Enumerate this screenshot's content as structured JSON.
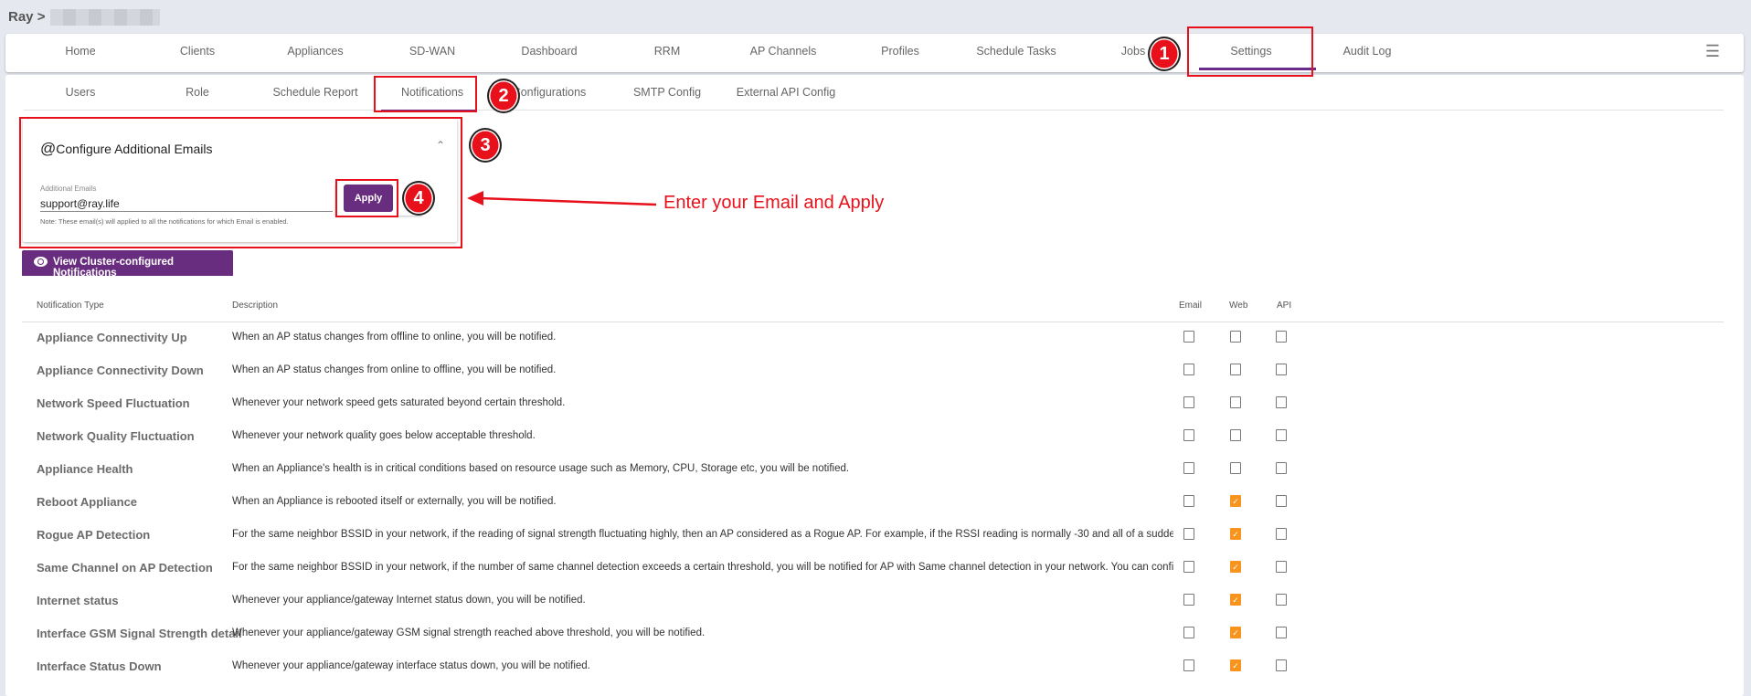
{
  "breadcrumb": {
    "root": "Ray",
    "separator": ">"
  },
  "topnav": {
    "items": [
      "Home",
      "Clients",
      "Appliances",
      "SD-WAN",
      "Dashboard",
      "RRM",
      "AP Channels",
      "Profiles",
      "Schedule Tasks",
      "Jobs",
      "Settings",
      "Audit Log"
    ],
    "active": "Settings"
  },
  "subtabs": {
    "items": [
      "Users",
      "Role",
      "Schedule Report",
      "Notifications",
      "Configurations",
      "SMTP Config",
      "External API Config"
    ],
    "active": "Notifications"
  },
  "email_card": {
    "title": "Configure Additional Emails",
    "field_label": "Additional Emails",
    "field_value": "support@ray.life",
    "note": "Note: These email(s) will applied to all the notifications for which Email is enabled.",
    "apply_label": "Apply"
  },
  "view_button": "View Cluster-configured Notifications",
  "table": {
    "headers": [
      "Notification Type",
      "Description",
      "Email",
      "Web",
      "API"
    ],
    "rows": [
      {
        "type": "Appliance Connectivity Up",
        "desc": "When an AP status changes from offline to online, you will be notified.",
        "email": false,
        "web": false,
        "api": false
      },
      {
        "type": "Appliance Connectivity Down",
        "desc": "When an AP status changes from online to offline, you will be notified.",
        "email": false,
        "web": false,
        "api": false
      },
      {
        "type": "Network Speed Fluctuation",
        "desc": "Whenever your network speed gets saturated beyond certain threshold.",
        "email": false,
        "web": false,
        "api": false
      },
      {
        "type": "Network Quality Fluctuation",
        "desc": "Whenever your network quality goes below acceptable threshold.",
        "email": false,
        "web": false,
        "api": false
      },
      {
        "type": "Appliance Health",
        "desc": "When an Appliance's health is in critical conditions based on resource usage such as Memory, CPU, Storage etc, you will be notified.",
        "email": false,
        "web": false,
        "api": false
      },
      {
        "type": "Reboot Appliance",
        "desc": "When an Appliance is rebooted itself or externally, you will be notified.",
        "email": false,
        "web": true,
        "api": false
      },
      {
        "type": "Rogue AP Detection",
        "desc": "For the same neighbor BSSID in your network, if the reading of signal strength fluctuating highly, then an AP considered as a Rogue AP. For example, if the RSSI reading is normally -30 and all of a sudden goes",
        "email": false,
        "web": true,
        "api": false
      },
      {
        "type": "Same Channel on AP Detection",
        "desc": "For the same neighbor BSSID in your network, if the number of same channel detection exceeds a certain threshold, you will be notified for AP with Same channel detection in your network. You can configure",
        "email": false,
        "web": true,
        "api": false
      },
      {
        "type": "Internet status",
        "desc": "Whenever your appliance/gateway Internet status down, you will be notified.",
        "email": false,
        "web": true,
        "api": false
      },
      {
        "type": "Interface GSM Signal Strength detail",
        "desc": "Whenever your appliance/gateway GSM signal strength reached above threshold, you will be notified.",
        "email": false,
        "web": true,
        "api": false
      },
      {
        "type": "Interface Status Down",
        "desc": "Whenever your appliance/gateway interface status down, you will be notified.",
        "email": false,
        "web": true,
        "api": false
      }
    ]
  },
  "annotations": {
    "badges": [
      "1",
      "2",
      "3",
      "4"
    ],
    "callout": "Enter your Email and Apply"
  },
  "colors": {
    "accent": "#692d7f",
    "checked": "#f7941d",
    "annotation": "#e8101a"
  }
}
